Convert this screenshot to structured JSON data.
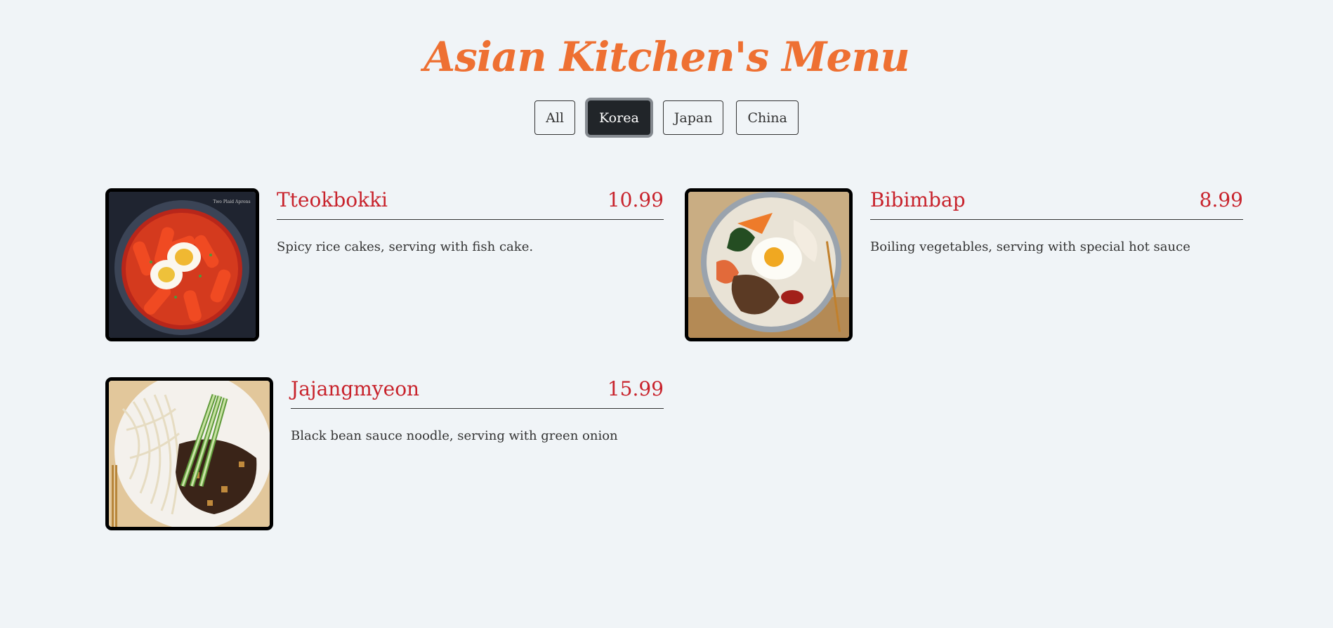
{
  "menu": {
    "title": "Asian Kitchen's Menu",
    "filters": [
      "All",
      "Korea",
      "Japan",
      "China"
    ],
    "active_filter": "Korea",
    "items": [
      {
        "name": "Tteokbokki",
        "price": "10.99",
        "description": "Spicy rice cakes, serving with fish cake.",
        "photo_watermark": "Two Plaid Aprons"
      },
      {
        "name": "Bibimbap",
        "price": "8.99",
        "description": "Boiling vegetables, serving with special hot sauce"
      },
      {
        "name": "Jajangmyeon",
        "price": "15.99",
        "description": "Black bean sauce noodle, serving with green onion"
      }
    ]
  },
  "colors": {
    "background": "#f0f4f7",
    "title": "#ee7032",
    "item_text": "#c8232c",
    "active_button": "#212529"
  }
}
